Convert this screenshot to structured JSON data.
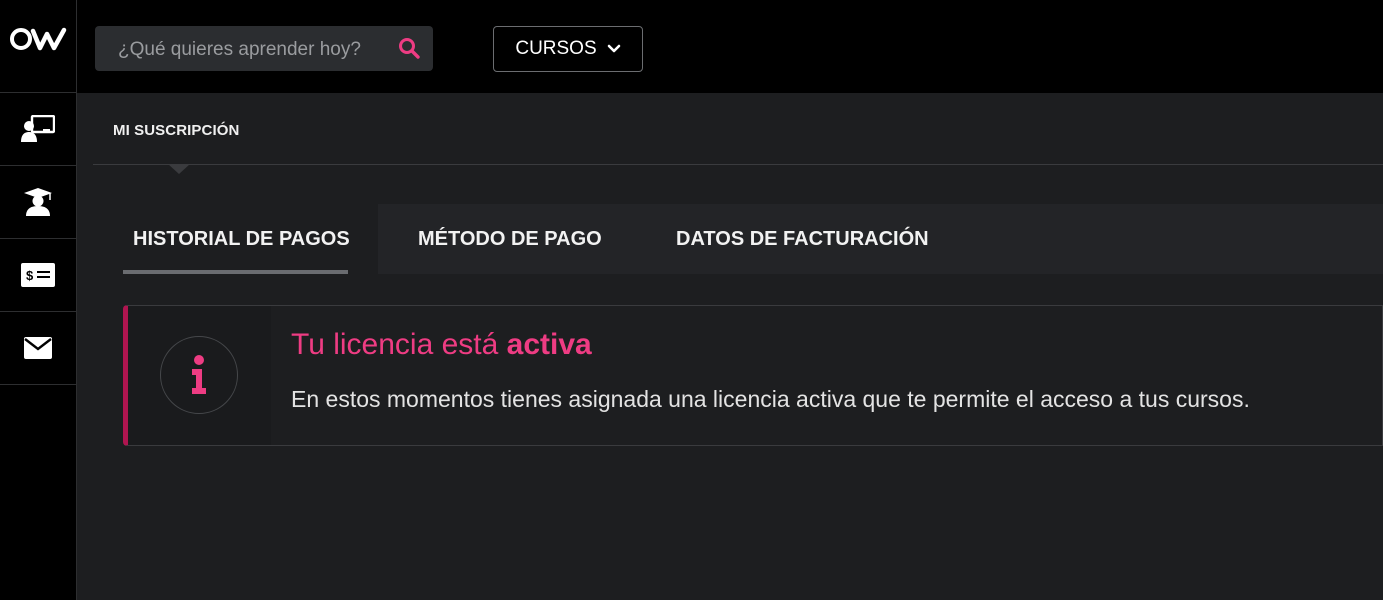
{
  "brand": {
    "logo_text": "OW",
    "accent": "#ee3c83",
    "alert_border": "#b01550"
  },
  "sidebar": {
    "items": [
      {
        "icon": "classroom-icon"
      },
      {
        "icon": "graduate-icon"
      },
      {
        "icon": "billing-icon",
        "glyph": "$"
      },
      {
        "icon": "mail-icon"
      }
    ]
  },
  "search": {
    "placeholder": "¿Qué quieres aprender hoy?",
    "icon": "search-icon"
  },
  "courses_menu": {
    "label": "CURSOS",
    "icon": "chevron-down-icon"
  },
  "subscription": {
    "title": "MI SUSCRIPCIÓN"
  },
  "tabs": [
    {
      "label": "HISTORIAL DE PAGOS",
      "active": true
    },
    {
      "label": "MÉTODO DE PAGO",
      "active": false
    },
    {
      "label": "DATOS DE FACTURACIÓN",
      "active": false
    }
  ],
  "alert": {
    "title_prefix": "Tu licencia está",
    "title_highlight": "activa",
    "message": "En estos momentos tienes asignada una licencia activa que te permite el acceso a tus cursos.",
    "icon": "info-icon"
  }
}
